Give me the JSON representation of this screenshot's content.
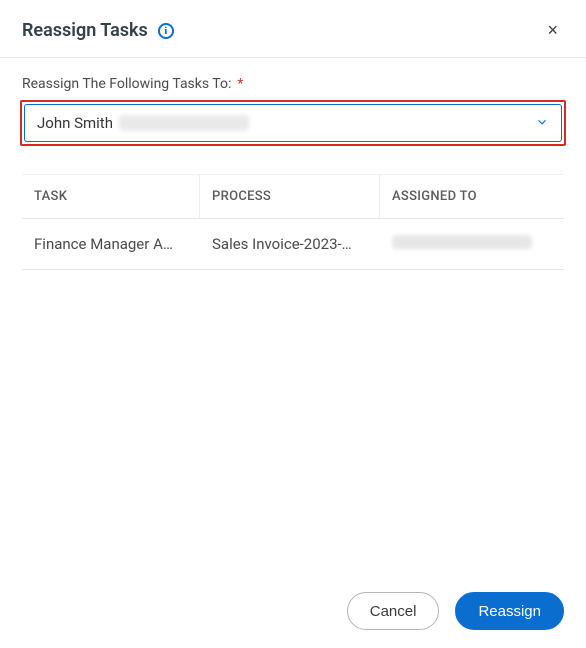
{
  "header": {
    "title": "Reassign Tasks",
    "info_icon_glyph": "i",
    "close_glyph": "×"
  },
  "field": {
    "label": "Reassign The Following Tasks To:",
    "required_glyph": "*",
    "selected_value": "John Smith"
  },
  "table": {
    "columns": {
      "task": "TASK",
      "process": "PROCESS",
      "assigned_to": "ASSIGNED TO"
    },
    "rows": [
      {
        "task": "Finance Manager A…",
        "process": "Sales Invoice-2023-…"
      }
    ]
  },
  "footer": {
    "cancel": "Cancel",
    "reassign": "Reassign"
  }
}
